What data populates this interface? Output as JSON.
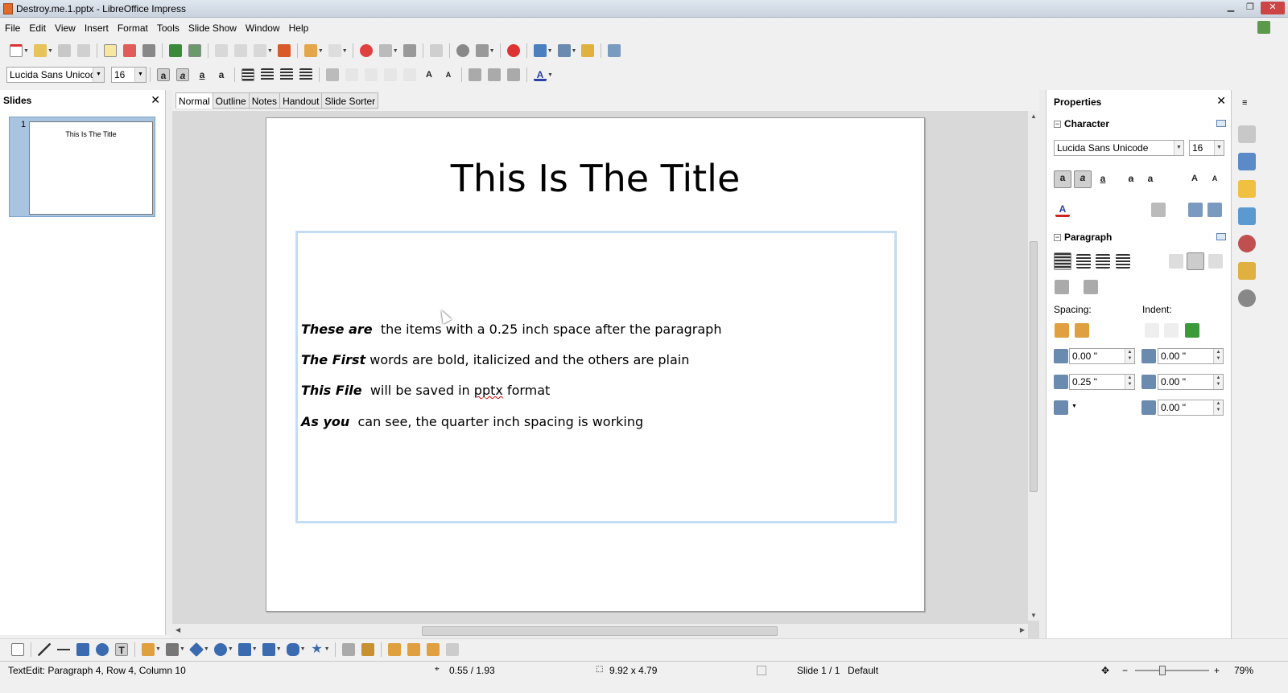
{
  "window": {
    "title": "Destroy.me.1.pptx - LibreOffice Impress",
    "minimize": "▁",
    "maximize": "❐",
    "close": "✕"
  },
  "menu": [
    "File",
    "Edit",
    "View",
    "Insert",
    "Format",
    "Tools",
    "Slide Show",
    "Window",
    "Help"
  ],
  "formatting": {
    "font_name": "Lucida Sans Unicod",
    "font_size": "16"
  },
  "slides_pane": {
    "title": "Slides",
    "close": "✕",
    "thumbnails": [
      {
        "number": "1",
        "title": "This Is The Title"
      }
    ]
  },
  "view_tabs": [
    "Normal",
    "Outline",
    "Notes",
    "Handout",
    "Slide Sorter"
  ],
  "active_tab": "Normal",
  "slide": {
    "title": "This Is The Title",
    "lines": [
      {
        "bold": "These are",
        "plain": "  the items with a 0.25 inch space after the paragraph"
      },
      {
        "bold": "The First",
        "plain": " words are bold, italicized and the others are plain"
      },
      {
        "bold": "This File",
        "plain_before": "  will be saved in ",
        "misspelled": "pptx",
        "plain_after": " format"
      },
      {
        "bold": "As you",
        "plain": "  can see, the quarter inch spacing is working"
      }
    ]
  },
  "properties": {
    "title": "Properties",
    "close": "✕",
    "character": {
      "label": "Character",
      "font_name": "Lucida Sans Unicode",
      "font_size": "16"
    },
    "paragraph": {
      "label": "Paragraph",
      "spacing_label": "Spacing:",
      "indent_label": "Indent:",
      "above_spacing": "0.00 \"",
      "below_spacing": "0.25 \"",
      "before_indent": "0.00 \"",
      "after_indent": "0.00 \"",
      "first_line_indent": "0.00 \""
    }
  },
  "status": {
    "edit_info": "TextEdit: Paragraph 4, Row 4, Column 10",
    "position": "0.55 / 1.93",
    "size": "9.92 x 4.79",
    "slide": "Slide 1 / 1",
    "layout": "Default",
    "zoom": "79%"
  },
  "colors": {
    "textbox_border": "#c4dcf6",
    "thumb_selected": "#a9c4e0",
    "spellcheck": "#dd0000"
  }
}
